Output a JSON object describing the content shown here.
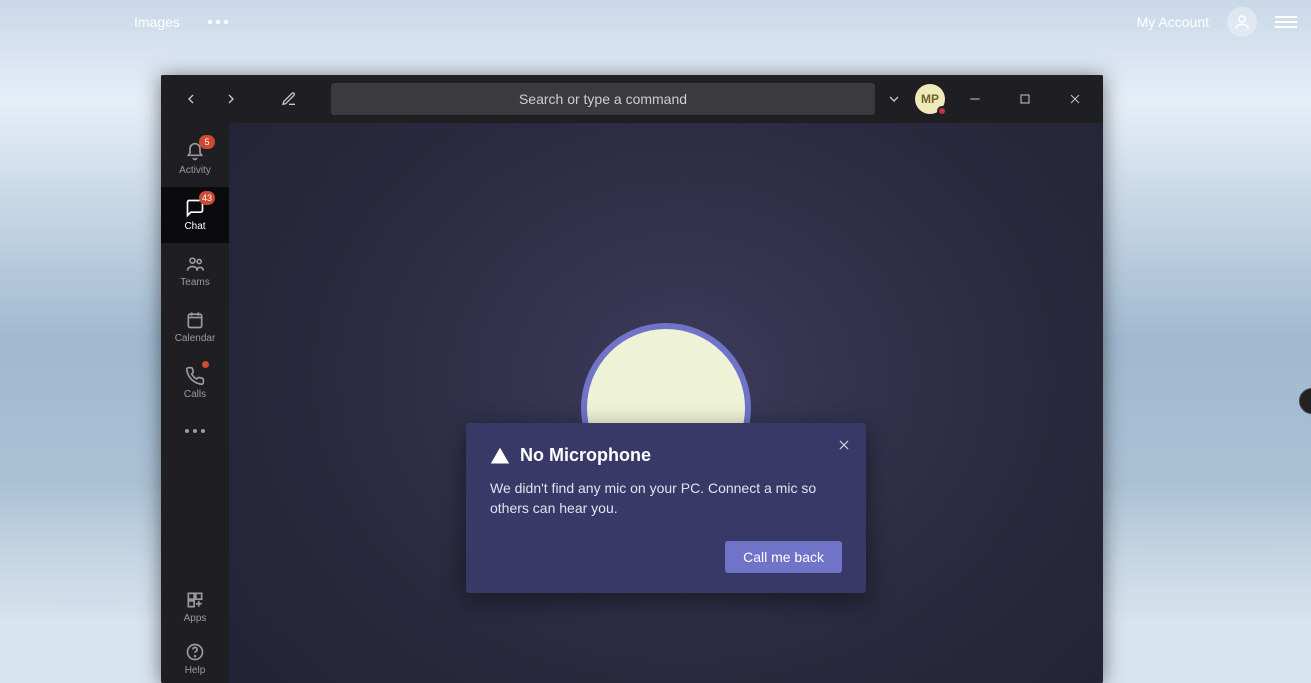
{
  "browser": {
    "images_label": "Images",
    "my_account": "My Account"
  },
  "teams": {
    "search_placeholder": "Search or type a command",
    "avatar_initials": "MP"
  },
  "rail": {
    "activity": {
      "label": "Activity",
      "badge": "5"
    },
    "chat": {
      "label": "Chat",
      "badge": "43"
    },
    "teams": {
      "label": "Teams"
    },
    "calendar": {
      "label": "Calendar"
    },
    "calls": {
      "label": "Calls"
    },
    "apps": {
      "label": "Apps"
    },
    "help": {
      "label": "Help"
    }
  },
  "modal": {
    "title": "No Microphone",
    "body": "We didn't find any mic on your PC. Connect a mic so others can hear you.",
    "button": "Call me back"
  }
}
